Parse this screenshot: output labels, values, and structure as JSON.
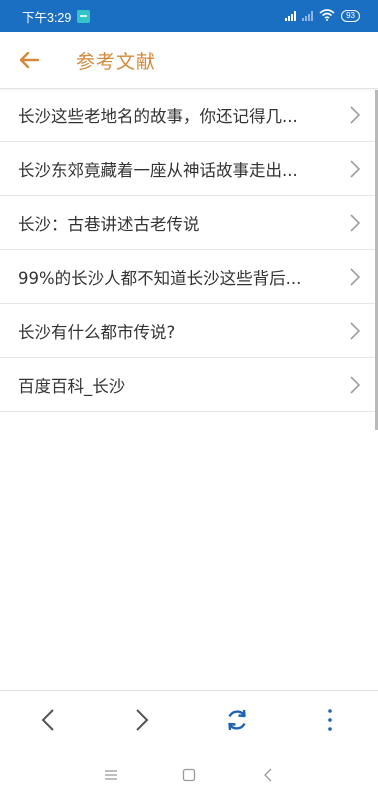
{
  "status_bar": {
    "time": "下午3:29",
    "battery": "93"
  },
  "header": {
    "title": "参考文献"
  },
  "references": [
    {
      "label": "长沙这些老地名的故事，你还记得几..."
    },
    {
      "label": "长沙东郊竟藏着一座从神话故事走出..."
    },
    {
      "label": "长沙：古巷讲述古老传说"
    },
    {
      "label": "99%的长沙人都不知道长沙这些背后..."
    },
    {
      "label": "长沙有什么都市传说?"
    },
    {
      "label": "百度百科_长沙"
    }
  ],
  "colors": {
    "status_bar_bg": "#1a6fc2",
    "title_accent": "#d5893a",
    "refresh_icon": "#1e63b5"
  }
}
